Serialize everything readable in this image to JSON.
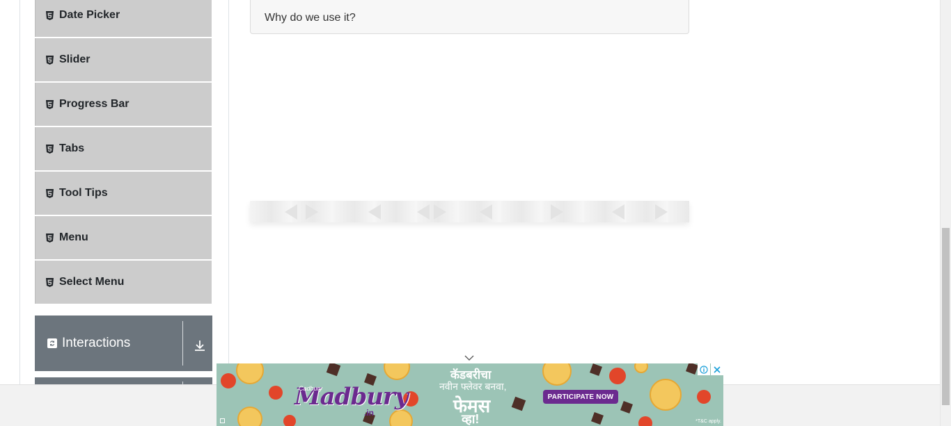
{
  "sidebar": {
    "items": [
      {
        "label": "Date Picker",
        "icon": "html5-icon"
      },
      {
        "label": "Slider",
        "icon": "html5-icon"
      },
      {
        "label": "Progress Bar",
        "icon": "html5-icon"
      },
      {
        "label": "Tabs",
        "icon": "html5-icon"
      },
      {
        "label": "Tool Tips",
        "icon": "html5-icon"
      },
      {
        "label": "Menu",
        "icon": "html5-icon"
      },
      {
        "label": "Select Menu",
        "icon": "html5-icon"
      }
    ],
    "groups": [
      {
        "title": "Interactions",
        "icon": "interactions-icon",
        "toggle_icon": "download-arrow-icon"
      }
    ]
  },
  "main": {
    "faq_question": "Why do we use it?"
  },
  "ad": {
    "brand": "Madbury",
    "brand_prefix": "Cadbury",
    "brand_suffix": ".in",
    "hindi_line1": "कॅडबरीचा",
    "hindi_line2": "नवीन फ्लेवर बनवा,",
    "hindi_line3": "फेमस",
    "hindi_line4": "व्हा!",
    "cta": "PARTICIPATE NOW",
    "terms": "*T&C apply.",
    "adchoices_icon": "info-icon",
    "close_icon": "close-icon"
  },
  "colors": {
    "sidebar_item_bg": "#cccccc",
    "group_header_bg": "#6c757d",
    "ad_bg": "#9cc4b6",
    "ad_brand": "#6b2a8f"
  }
}
